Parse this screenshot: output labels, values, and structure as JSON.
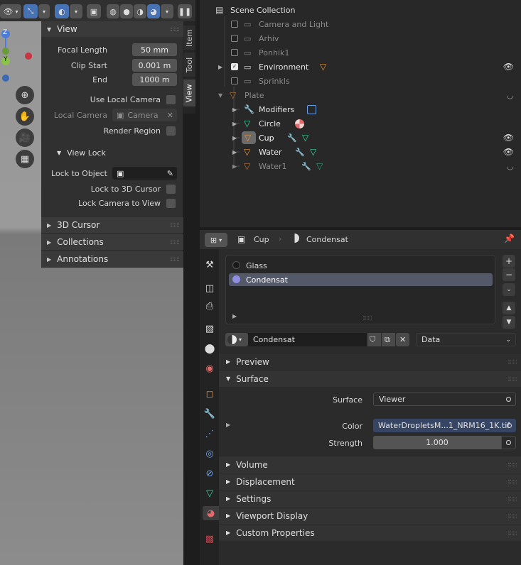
{
  "npanel": {
    "tabs": [
      "Item",
      "Tool",
      "View"
    ],
    "view": {
      "title": "View",
      "focal_length_label": "Focal Length",
      "focal_length": "50 mm",
      "clip_start_label": "Clip Start",
      "clip_start": "0.001 m",
      "clip_end_label": "End",
      "clip_end": "1000 m",
      "use_local_camera": "Use Local Camera",
      "local_camera_label": "Local Camera",
      "local_camera_value": "Camera",
      "render_region": "Render Region"
    },
    "view_lock": {
      "title": "View Lock",
      "lock_to_object": "Lock to Object",
      "lock_to_3d_cursor": "Lock to 3D Cursor",
      "lock_camera_to_view": "Lock Camera to View"
    },
    "collapsed_sections": [
      "3D Cursor",
      "Collections",
      "Annotations"
    ]
  },
  "gizmo": {
    "z": "Z",
    "y": "Y"
  },
  "outliner": {
    "rows": [
      {
        "label": "Scene Collection"
      },
      {
        "label": "Camera and Light"
      },
      {
        "label": "Arhiv"
      },
      {
        "label": "Ponhik1"
      },
      {
        "label": "Environment"
      },
      {
        "label": "Sprinkls"
      },
      {
        "label": "Plate"
      },
      {
        "label": "Modifiers"
      },
      {
        "label": "Circle"
      },
      {
        "label": "Cup"
      },
      {
        "label": "Water"
      },
      {
        "label": "Water1"
      }
    ]
  },
  "properties": {
    "breadcrumb_object": "Cup",
    "breadcrumb_material": "Condensat",
    "material_slots": [
      "Glass",
      "Condensat"
    ],
    "selected_slot": 1,
    "material_name": "Condensat",
    "link_mode": "Data",
    "sections": {
      "preview": "Preview",
      "surface": "Surface",
      "volume": "Volume",
      "displacement": "Displacement",
      "settings": "Settings",
      "viewport_display": "Viewport Display",
      "custom_properties": "Custom Properties"
    },
    "surface_label": "Surface",
    "surface_value": "Viewer",
    "color_label": "Color",
    "color_value": "WaterDropletsM...1_NRM16_1K.tif",
    "strength_label": "Strength",
    "strength_value": "1.000"
  },
  "colors": {
    "accent_blue": "#4772b3",
    "selection": "#54596a",
    "object_orange": "#e8913a",
    "mesh_green": "#3ad59a",
    "material_red": "#e26a6a"
  }
}
